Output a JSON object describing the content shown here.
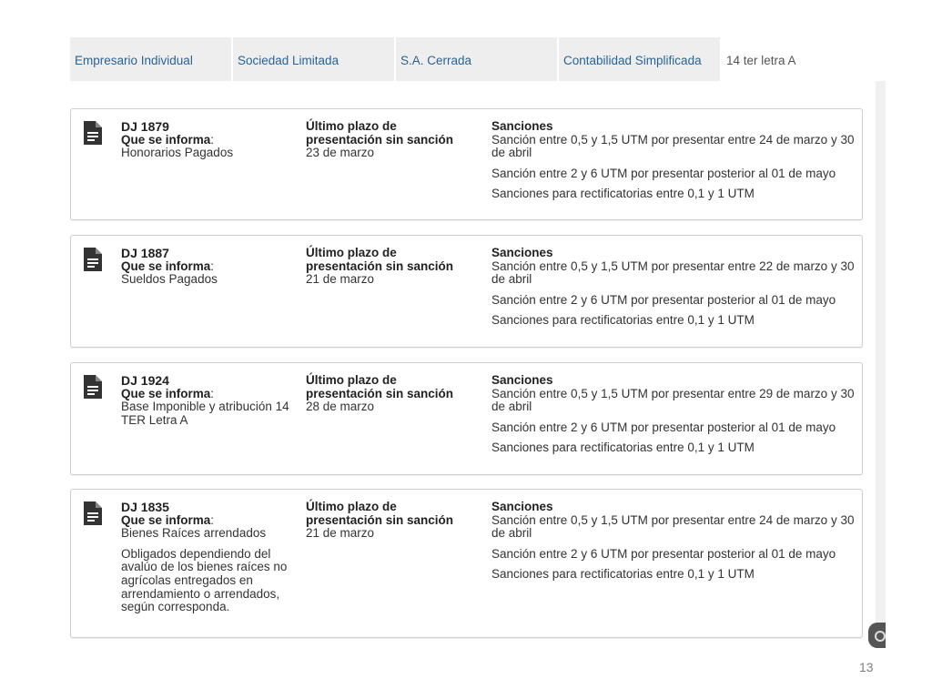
{
  "tabs": [
    {
      "label": "Empresario Individual"
    },
    {
      "label": "Sociedad Limitada"
    },
    {
      "label": "S.A. Cerrada"
    },
    {
      "label": "Contabilidad Simplificada"
    },
    {
      "label": "14 ter letra A",
      "active": true
    }
  ],
  "labels": {
    "informa": "Que se informa",
    "plazo_line1": "Último plazo de",
    "plazo_line2": "presentación sin sanción",
    "sanciones": "Sanciones"
  },
  "cards": [
    {
      "dj": "DJ 1879",
      "informa_value": "Honorarios Pagados",
      "note": "",
      "plazo": "23 de marzo",
      "sanciones": [
        "Sanción entre 0,5 y 1,5 UTM por presentar entre 24 de marzo y 30 de abril",
        "Sanción entre 2 y 6 UTM por presentar posterior al 01 de mayo",
        "Sanciones para rectificatorias entre 0,1 y 1 UTM"
      ]
    },
    {
      "dj": "DJ 1887",
      "informa_value": "Sueldos Pagados",
      "note": "",
      "plazo": "21 de marzo",
      "sanciones": [
        "Sanción entre 0,5 y 1,5 UTM por presentar entre 22 de marzo y 30 de abril",
        "Sanción entre 2 y 6 UTM por presentar posterior al 01 de mayo",
        "Sanciones para rectificatorias entre 0,1 y 1 UTM"
      ]
    },
    {
      "dj": "DJ 1924",
      "informa_value": "Base Imponible y atribución 14 TER Letra A",
      "note": "",
      "plazo": "28 de marzo",
      "sanciones": [
        "Sanción entre 0,5 y 1,5 UTM por presentar entre 29 de marzo y 30 de abril",
        "Sanción entre 2 y 6 UTM por presentar posterior al 01 de mayo",
        "Sanciones para rectificatorias entre 0,1 y 1 UTM"
      ]
    },
    {
      "dj": "DJ 1835",
      "informa_value": "Bienes Raíces arrendados",
      "note": "Obligados dependiendo del avalúo de los bienes raíces no agrícolas entregados en arrendamiento o arrendados, según corresponda.",
      "plazo": "21 de marzo",
      "sanciones": [
        "Sanción entre 0,5 y 1,5 UTM por presentar entre 24 de marzo y 30 de abril",
        "Sanción entre 2 y 6 UTM por presentar posterior al 01 de mayo",
        "Sanciones para rectificatorias entre 0,1 y 1 UTM"
      ]
    }
  ],
  "page_number": "13",
  "colors": {
    "tab_link": "#2a6496",
    "tab_bg": "#eeeeee",
    "card_border": "#cfcfcf",
    "text": "#333333"
  },
  "icons": {
    "card": "document-icon",
    "corner": "chat-widget-icon"
  }
}
